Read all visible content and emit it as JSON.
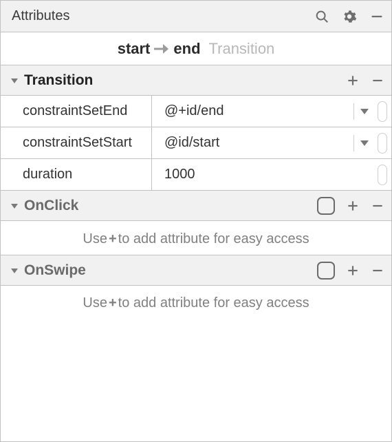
{
  "header": {
    "title": "Attributes"
  },
  "transition_bar": {
    "start": "start",
    "end": "end",
    "type": "Transition"
  },
  "sections": {
    "transition": {
      "title": "Transition",
      "rows": {
        "constraintSetEnd": {
          "label": "constraintSetEnd",
          "value": "@+id/end"
        },
        "constraintSetStart": {
          "label": "constraintSetStart",
          "value": "@id/start"
        },
        "duration": {
          "label": "duration",
          "value": "1000"
        }
      }
    },
    "onclick": {
      "title": "OnClick",
      "hint_pre": "Use ",
      "hint_plus": "+",
      "hint_post": " to add attribute for easy access"
    },
    "onswipe": {
      "title": "OnSwipe",
      "hint_pre": "Use ",
      "hint_plus": "+",
      "hint_post": " to add attribute for easy access"
    }
  }
}
